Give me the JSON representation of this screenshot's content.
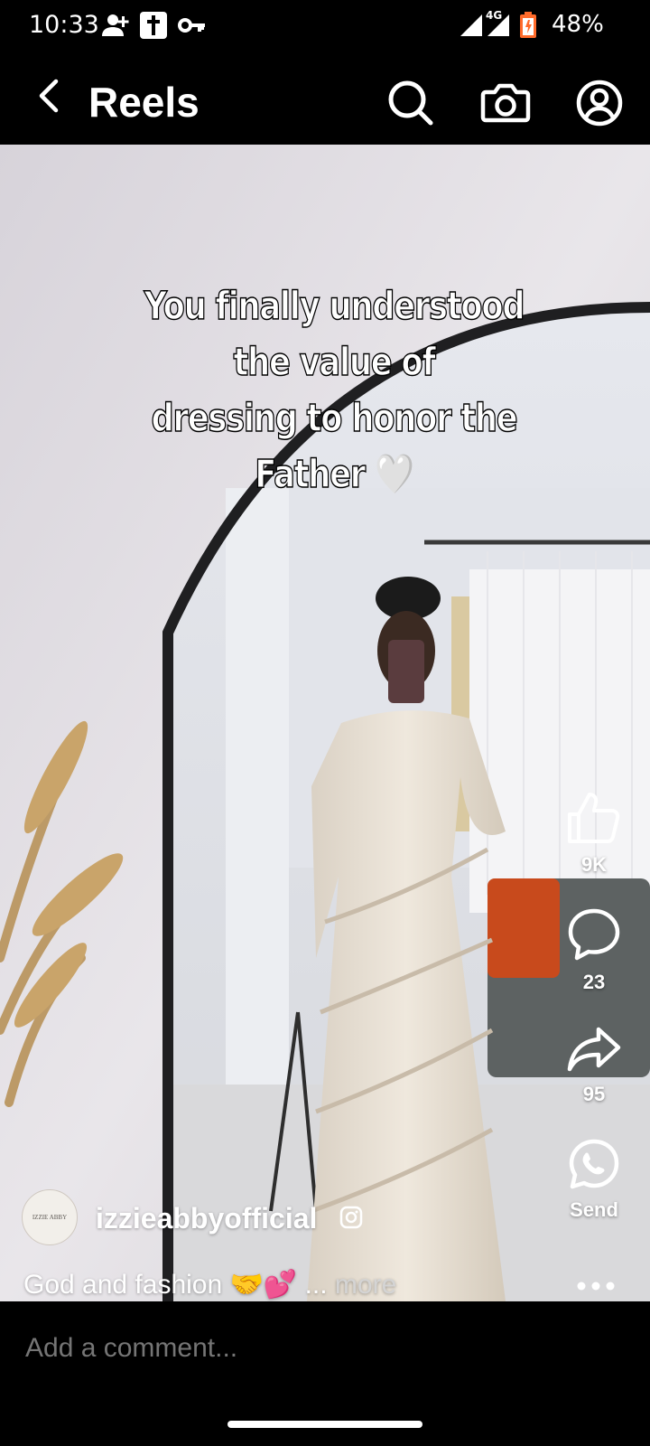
{
  "status_bar": {
    "time": "10:33",
    "network": "4G",
    "battery": "48%",
    "icons": [
      "person-add-icon",
      "cross-icon",
      "key-icon",
      "signal-icon",
      "battery-icon"
    ]
  },
  "header": {
    "title": "Reels",
    "back_icon": "back-arrow-icon",
    "search_icon": "search-icon",
    "camera_icon": "camera-icon",
    "profile_icon": "profile-icon"
  },
  "video": {
    "overlay_line1": "You finally understood the value of",
    "overlay_line2": "dressing to honor the Father",
    "overlay_emoji": "🤍"
  },
  "actions": {
    "like_count": "9K",
    "comment_count": "23",
    "share_count": "95",
    "send_label": "Send"
  },
  "post": {
    "username": "izzieabbyofficial",
    "avatar_line1": "IZZIE ABBY",
    "caption": "God and fashion ",
    "caption_emoji": "🤝💕",
    "caption_ellipsis": " ... ",
    "more_label": "more"
  },
  "comment": {
    "placeholder": "Add a comment..."
  },
  "colors": {
    "background": "#000000",
    "text": "#ffffff",
    "muted": "#8f8f8f"
  }
}
